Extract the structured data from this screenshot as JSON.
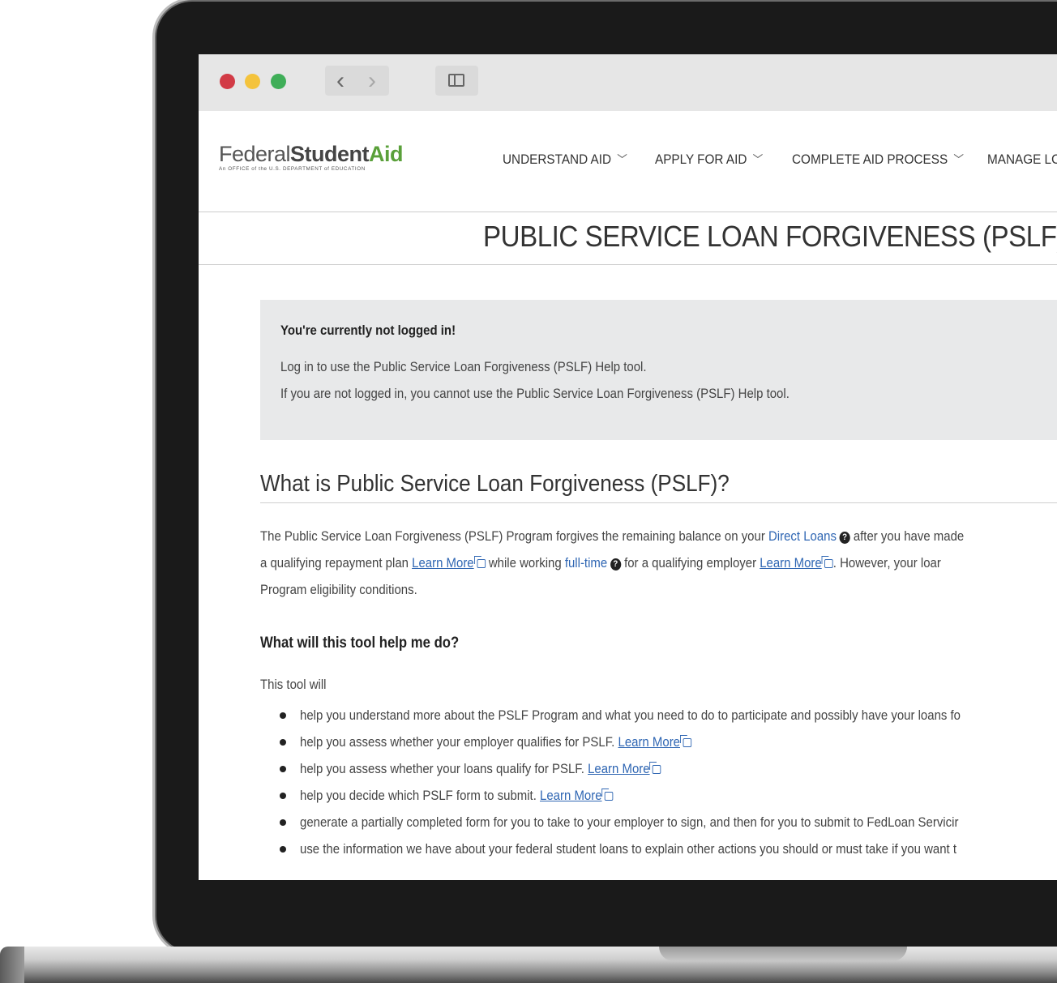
{
  "browser": {
    "back_glyph": "‹",
    "forward_glyph": "›"
  },
  "logo": {
    "federal": "Federal",
    "student": "Student",
    "aid": "Aid",
    "subtitle": "An OFFICE of the U.S. DEPARTMENT of EDUCATION"
  },
  "nav": {
    "items": [
      {
        "label": "UNDERSTAND AID",
        "icon": "chevron-down-icon"
      },
      {
        "label": "APPLY FOR AID",
        "icon": "chevron-down-icon"
      },
      {
        "label": "COMPLETE AID PROCESS",
        "icon": "chevron-down-icon"
      },
      {
        "label": "MANAGE LOA"
      }
    ]
  },
  "page": {
    "title": "PUBLIC SERVICE LOAN FORGIVENESS (PSLF) HELP T"
  },
  "notice": {
    "heading": "You're currently not logged in!",
    "line1": "Log in to use the Public Service Loan Forgiveness (PSLF) Help tool.",
    "line2": "If you are not logged in, you cannot use the Public Service Loan Forgiveness (PSLF) Help tool."
  },
  "section": {
    "heading": "What is Public Service Loan Forgiveness (PSLF)?",
    "p1_a": "The Public Service Loan Forgiveness (PSLF) Program forgives the remaining balance on your ",
    "p1_link": "Direct Loans",
    "p1_b": " after you have made",
    "p2_a": "a qualifying repayment plan ",
    "learn_more": "Learn More",
    "p2_b": " while working ",
    "p2_link": "full-time",
    "p2_c": " for a qualifying employer ",
    "p2_d": ". However, your loar",
    "p3": "Program eligibility conditions."
  },
  "tool": {
    "heading": "What will this tool help me do?",
    "intro": "This tool will",
    "items": [
      {
        "text": "help you understand more about the PSLF Program and what you need to do to participate and possibly have your loans fo",
        "link": ""
      },
      {
        "text": "help you assess whether your employer qualifies for PSLF. ",
        "link": "Learn More"
      },
      {
        "text": "help you assess whether your loans qualify for PSLF. ",
        "link": "Learn More"
      },
      {
        "text": "help you decide which PSLF form to submit. ",
        "link": "Learn More"
      },
      {
        "text": "generate a partially completed form for you to take to your employer to sign, and then for you to submit to FedLoan Servicir",
        "link": ""
      },
      {
        "text": "use the information we have about your federal student loans to explain other actions you should or must take if you want t",
        "link": ""
      }
    ]
  }
}
